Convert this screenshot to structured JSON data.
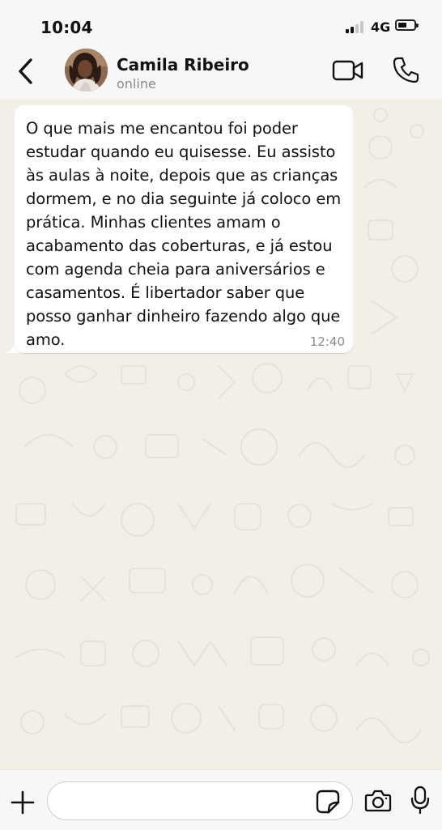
{
  "status_bar": {
    "time": "10:04",
    "network": "4G"
  },
  "header": {
    "contact_name": "Camila Ribeiro",
    "contact_status": "online"
  },
  "messages": [
    {
      "direction": "incoming",
      "text": "O que mais me encantou foi poder estudar quando eu quisesse. Eu assisto às aulas à noite, depois que as crianças dormem, e no dia seguinte já coloco em prática. Minhas clientes amam o acabamento das coberturas, e já estou com agenda cheia para aniversários e casamentos. É libertador saber que posso ganhar dinheiro fazendo algo que amo.",
      "time": "12:40"
    }
  ],
  "composer": {
    "value": "",
    "placeholder": ""
  },
  "icons": {
    "back": "chevron-left-icon",
    "video": "video-camera-icon",
    "call": "phone-icon",
    "add": "plus-icon",
    "sticker": "sticker-icon",
    "camera": "camera-icon",
    "mic": "microphone-icon"
  },
  "colors": {
    "chat_background": "#f3efe7",
    "bubble": "#ffffff",
    "timestamp": "#8c8c8c",
    "secondary_text": "#8a8a8a"
  }
}
